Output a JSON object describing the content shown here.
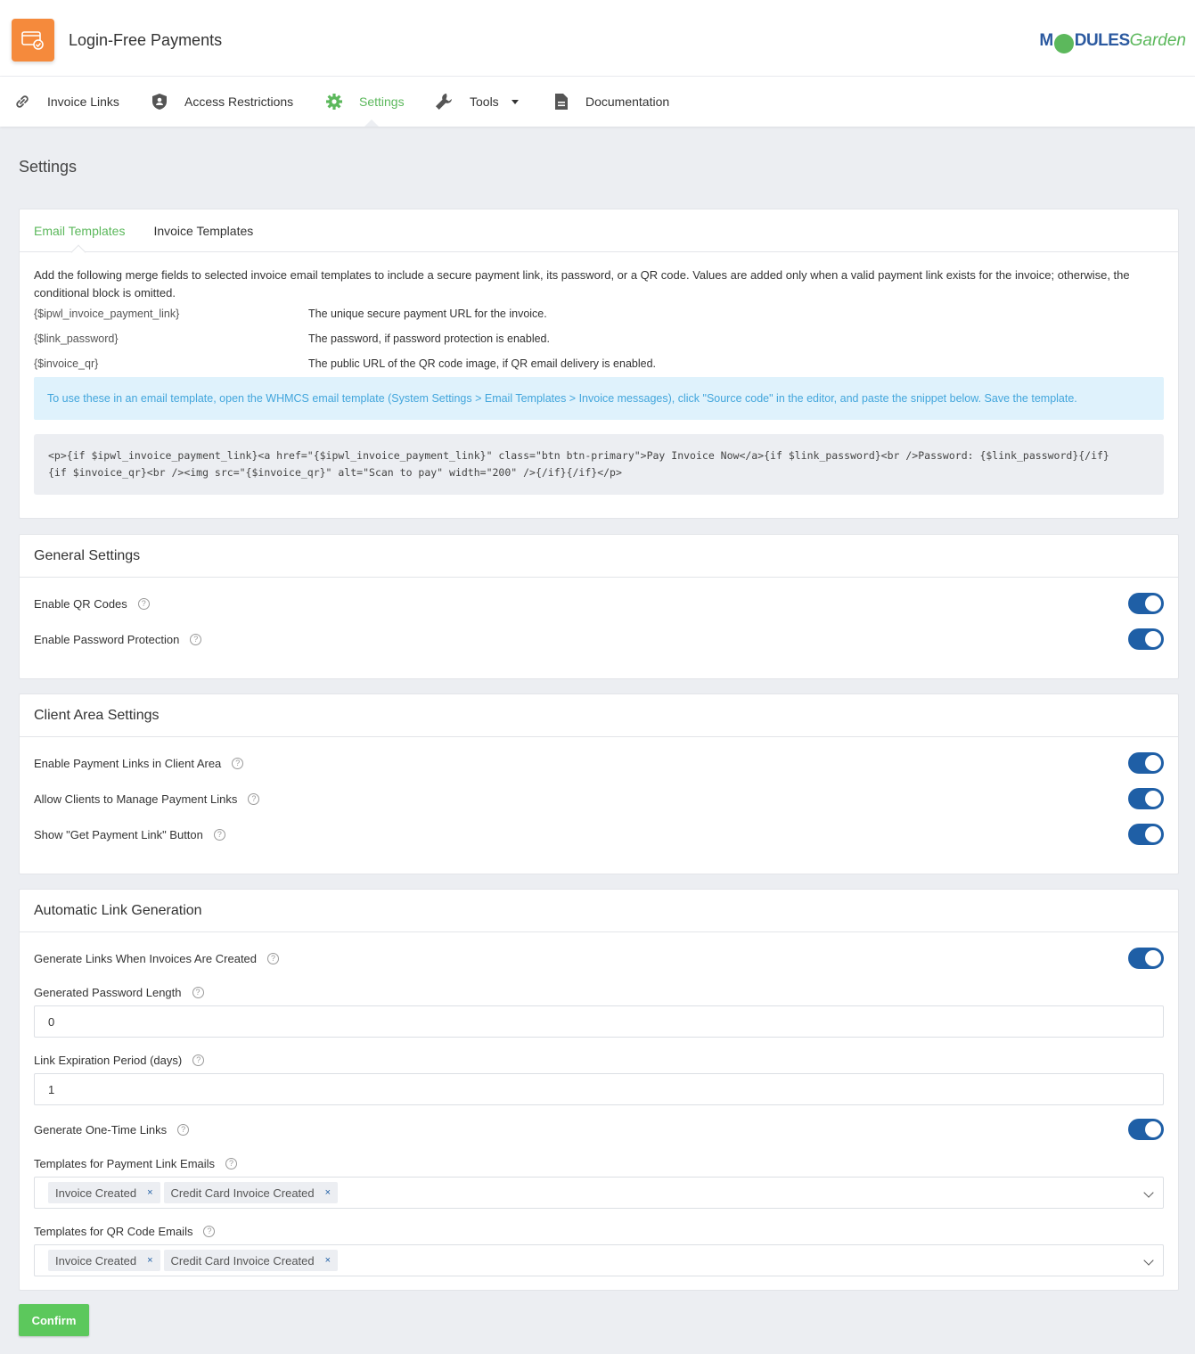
{
  "app": {
    "title": "Login-Free Payments"
  },
  "logo": {
    "prefix": "M",
    "mid": "DULES",
    "suffix": "Garden"
  },
  "nav": {
    "items": [
      {
        "label": "Invoice Links",
        "icon": "link-icon"
      },
      {
        "label": "Access Restrictions",
        "icon": "shield-icon"
      },
      {
        "label": "Settings",
        "icon": "gear-icon",
        "active": true
      },
      {
        "label": "Tools",
        "icon": "wrench-icon"
      },
      {
        "label": "Documentation",
        "icon": "document-icon"
      }
    ]
  },
  "page": {
    "title": "Settings"
  },
  "templates_card": {
    "tabs": [
      "Email Templates",
      "Invoice Templates"
    ],
    "description": "Add the following merge fields to selected invoice email templates to include a secure payment link, its password, or a QR code. Values are added only when a valid payment link exists for the invoice; otherwise, the conditional block is omitted.",
    "merge_fields": [
      {
        "field": "{$ipwl_invoice_payment_link}",
        "desc": "The unique secure payment URL for the invoice."
      },
      {
        "field": "{$link_password}",
        "desc": "The password, if password protection is enabled."
      },
      {
        "field": "{$invoice_qr}",
        "desc": "The public URL of the QR code image, if QR email delivery is enabled."
      }
    ],
    "info": "To use these in an email template, open the WHMCS email template (System Settings > Email Templates > Invoice messages), click \"Source code\" in the editor, and paste the snippet below. Save the template.",
    "code_line1": "<p>{if $ipwl_invoice_payment_link}<a href=\"{$ipwl_invoice_payment_link}\" class=\"btn btn-primary\">Pay Invoice Now</a>{if $link_password}<br />Password: {$link_password}{/if}",
    "code_line2": "{if $invoice_qr}<br /><img src=\"{$invoice_qr}\" alt=\"Scan to pay\" width=\"200\" />{/if}{/if}</p>"
  },
  "general": {
    "title": "General Settings",
    "rows": [
      {
        "label": "Enable QR Codes",
        "on": true
      },
      {
        "label": "Enable Password Protection",
        "on": true
      }
    ]
  },
  "client_area": {
    "title": "Client Area Settings",
    "rows": [
      {
        "label": "Enable Payment Links in Client Area",
        "on": true
      },
      {
        "label": "Allow Clients to Manage Payment Links",
        "on": true
      },
      {
        "label": "Show \"Get Payment Link\" Button",
        "on": true
      }
    ]
  },
  "auto": {
    "title": "Automatic Link Generation",
    "gen_on_create": "Generate Links When Invoices Are Created",
    "pwd_len_label": "Generated Password Length",
    "pwd_len_value": "0",
    "expiry_label": "Link Expiration Period (days)",
    "expiry_value": "1",
    "one_time_label": "Generate One-Time Links",
    "pl_templates_label": "Templates for Payment Link Emails",
    "pl_templates": [
      "Invoice Created",
      "Credit Card Invoice Created"
    ],
    "qr_templates_label": "Templates for QR Code Emails",
    "qr_templates": [
      "Invoice Created",
      "Credit Card Invoice Created"
    ]
  },
  "help_glyph": "?",
  "tag_remove": "×",
  "confirm": "Confirm",
  "colors": {
    "accent": "#5cb85c",
    "toggle": "#1f5fa6",
    "app_icon": "#f58a3c",
    "info_bg": "#dff2fc"
  }
}
